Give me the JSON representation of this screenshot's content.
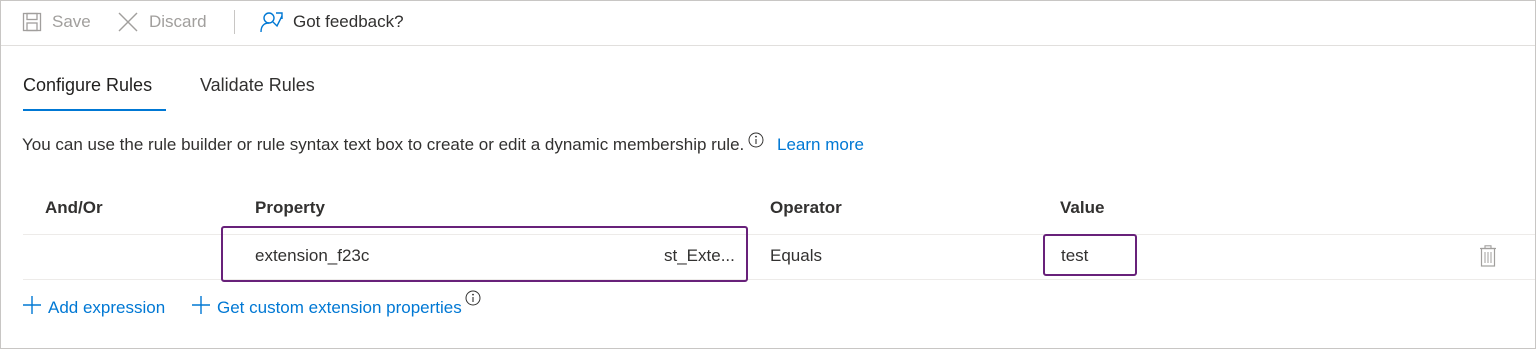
{
  "toolbar": {
    "save_label": "Save",
    "discard_label": "Discard",
    "feedback_label": "Got feedback?"
  },
  "tabs": [
    {
      "label": "Configure Rules",
      "active": true
    },
    {
      "label": "Validate Rules",
      "active": false
    }
  ],
  "description": {
    "text": "You can use the rule builder or rule syntax text box to create or edit a dynamic membership rule.",
    "learn_more": "Learn more"
  },
  "table": {
    "headers": {
      "and_or": "And/Or",
      "property": "Property",
      "operator": "Operator",
      "value": "Value"
    },
    "rows": [
      {
        "and_or": "",
        "property_start": "extension_f23c",
        "property_end": "st_Exte...",
        "operator": "Equals",
        "value": "test"
      }
    ]
  },
  "actions": {
    "add_expression": "Add expression",
    "get_custom_extension": "Get custom extension properties"
  },
  "colors": {
    "accent": "#0078d4",
    "highlight": "#68217a",
    "disabled": "#a19f9d"
  }
}
